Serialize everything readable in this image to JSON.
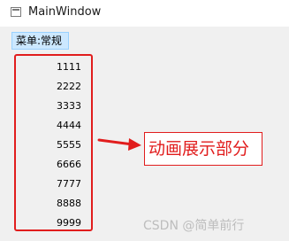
{
  "window": {
    "title": "MainWindow"
  },
  "menubar": {
    "items": [
      {
        "label": "菜单:常规"
      }
    ]
  },
  "list": {
    "items": [
      "1111",
      "2222",
      "3333",
      "4444",
      "5555",
      "6666",
      "7777",
      "8888",
      "9999"
    ]
  },
  "annotation": {
    "label": "动画展示部分",
    "color": "#e11d1d"
  },
  "watermark": {
    "text": "CSDN @简单前行"
  }
}
